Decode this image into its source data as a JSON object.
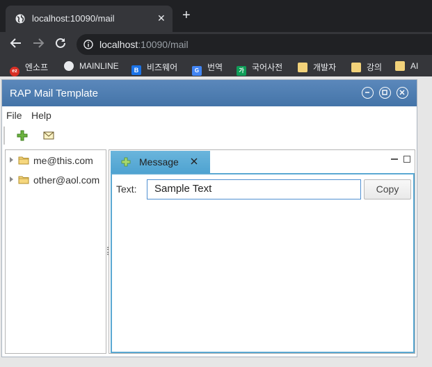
{
  "browser": {
    "tab_title": "localhost:10090/mail",
    "tab_close": "✕",
    "new_tab": "+",
    "url_host": "localhost",
    "url_rest": ":10090/mail",
    "bookmarks": [
      {
        "label": "엔소프",
        "icon": "ez-icon",
        "color": "#d93025"
      },
      {
        "label": "MAINLINE",
        "icon": "globe-icon",
        "color": "#e8eaed"
      },
      {
        "label": "비즈웨어",
        "icon": "b-icon",
        "color": "#1a73e8"
      },
      {
        "label": "번역",
        "icon": "translate-icon",
        "color": "#4285f4"
      },
      {
        "label": "국어사전",
        "icon": "dictionary-icon",
        "color": "#0f9d58"
      },
      {
        "label": "개발자",
        "icon": "folder-icon",
        "color": "#f2d27a"
      },
      {
        "label": "강의",
        "icon": "folder-icon",
        "color": "#f2d27a"
      },
      {
        "label": "AI",
        "icon": "folder-icon",
        "color": "#f2d27a"
      }
    ]
  },
  "app": {
    "title": "RAP Mail Template",
    "menu": [
      "File",
      "Help"
    ],
    "tree": [
      "me@this.com",
      "other@aol.com"
    ],
    "editor_tab": "Message",
    "field_label": "Text:",
    "field_value": "Sample Text",
    "copy_button": "Copy"
  },
  "colors": {
    "titlebar": "#4a7bb0",
    "tab_active": "#5aa8d2",
    "input_border": "#4f8fd1"
  }
}
